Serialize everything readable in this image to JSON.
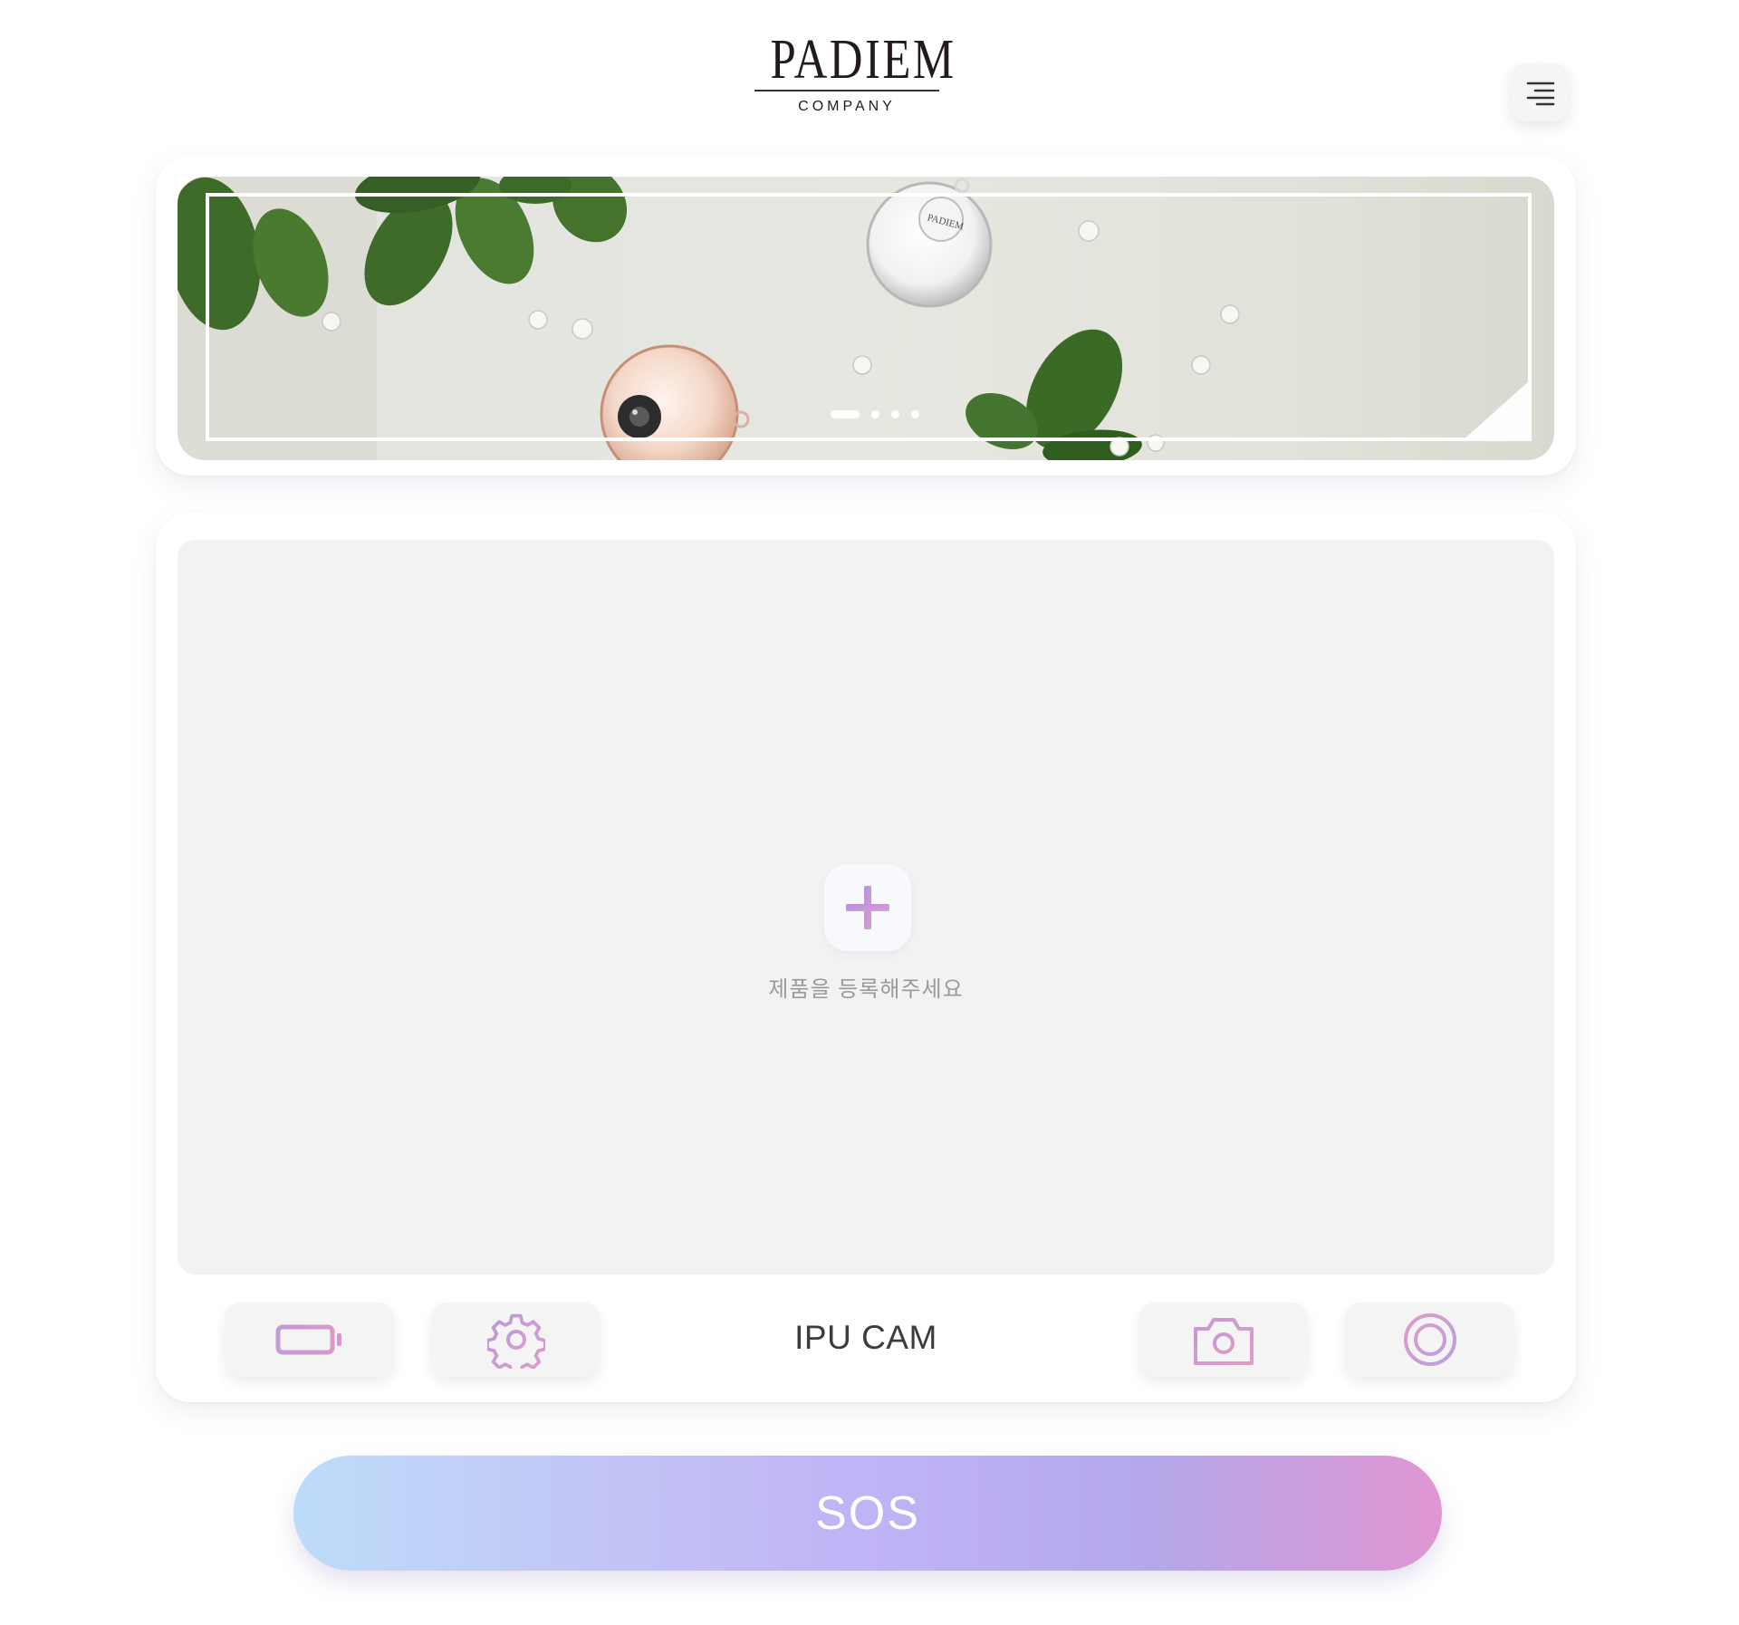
{
  "header": {
    "logo_word": "PADIEM",
    "logo_sub": "COMPANY",
    "menu_icon": "menu-icon"
  },
  "banner": {
    "slide_count": 4,
    "active_slide": 1,
    "product_label": "PADIEM"
  },
  "main": {
    "add_icon": "plus-icon",
    "add_prompt": "제품을 등록해주세요",
    "device_name": "IPU CAM",
    "controls": {
      "battery_icon": "battery-icon",
      "settings_icon": "gear-icon",
      "camera_icon": "camera-icon",
      "record_icon": "record-icon"
    }
  },
  "sos": {
    "label": "SOS"
  },
  "colors": {
    "icon_gradient_start": "#b88fd8",
    "icon_gradient_end": "#e39fc6",
    "sos_gradient": [
      "#bddcf9",
      "#c0b3f6",
      "#e096d2"
    ]
  }
}
